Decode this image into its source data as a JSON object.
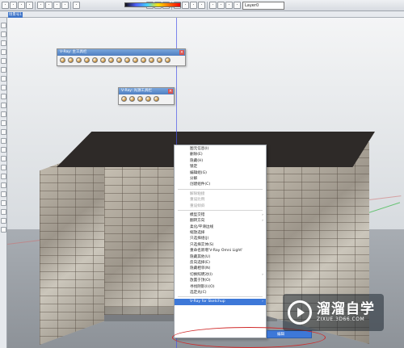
{
  "toolbar": {
    "layer_name": "Layer0",
    "icons": [
      "select-icon",
      "eraser-icon",
      "paint-icon",
      "pencil-icon",
      "shape-icon",
      "push-pull-icon",
      "move-icon",
      "rotate-icon",
      "scale-icon",
      "offset-icon",
      "tape-icon",
      "text-icon",
      "axes-icon",
      "orbit-icon",
      "pan-icon",
      "zoom-icon",
      "zoom-extents-icon",
      "camera-icon",
      "walk-icon",
      "section-icon"
    ]
  },
  "scene_tab": "场景号1",
  "vray_main_toolbar": {
    "title": "V-Ray: 主工具栏"
  },
  "vray_light_toolbar": {
    "title": "V-Ray: 光源工具栏"
  },
  "context_menu": {
    "items": [
      {
        "label": "图元信息(I)",
        "disabled": false,
        "submenu": false
      },
      {
        "label": "删除(E)",
        "disabled": false,
        "submenu": false
      },
      {
        "label": "隐藏(H)",
        "disabled": false,
        "submenu": false
      },
      {
        "label": "锁定",
        "disabled": false,
        "submenu": false
      },
      {
        "label": "编辑组(G)",
        "disabled": false,
        "submenu": false
      },
      {
        "label": "分解",
        "disabled": false,
        "submenu": false
      },
      {
        "label": "创建组件(C)",
        "disabled": false,
        "submenu": false
      },
      {
        "sep": true
      },
      {
        "label": "解除粘接",
        "disabled": true,
        "submenu": false
      },
      {
        "label": "重设比例",
        "disabled": true,
        "submenu": false
      },
      {
        "label": "重设倾斜",
        "disabled": true,
        "submenu": false
      },
      {
        "sep": true
      },
      {
        "label": "模型交错",
        "disabled": false,
        "submenu": true
      },
      {
        "label": "翻转方向",
        "disabled": false,
        "submenu": true
      },
      {
        "label": "柔化/平滑边线",
        "disabled": false,
        "submenu": false
      },
      {
        "label": "缩放选择",
        "disabled": false,
        "submenu": false
      },
      {
        "label": "只选择组(J)",
        "disabled": false,
        "submenu": false
      },
      {
        "label": "只选择实体(S)",
        "disabled": false,
        "submenu": false
      },
      {
        "label": "重命名新增'V-Ray Omni Light'",
        "disabled": false,
        "submenu": false
      },
      {
        "label": "隐藏其他(U)",
        "disabled": false,
        "submenu": false
      },
      {
        "label": "反向选择(E)",
        "disabled": false,
        "submenu": false
      },
      {
        "label": "隐藏相邻(N)",
        "disabled": false,
        "submenu": false
      },
      {
        "label": "切换照明对(I)",
        "disabled": false,
        "submenu": true
      },
      {
        "label": "放置于顶(O)",
        "disabled": false,
        "submenu": false
      },
      {
        "label": "寻找阴影(I)(O)",
        "disabled": false,
        "submenu": false
      },
      {
        "label": "选定光(C)",
        "disabled": false,
        "submenu": false
      }
    ],
    "highlight_item": "V-Ray for Sketchup",
    "submenu_item": "编辑"
  },
  "watermark": {
    "cn": "溜溜自学",
    "en": "ZIXUE.3D66.COM"
  }
}
